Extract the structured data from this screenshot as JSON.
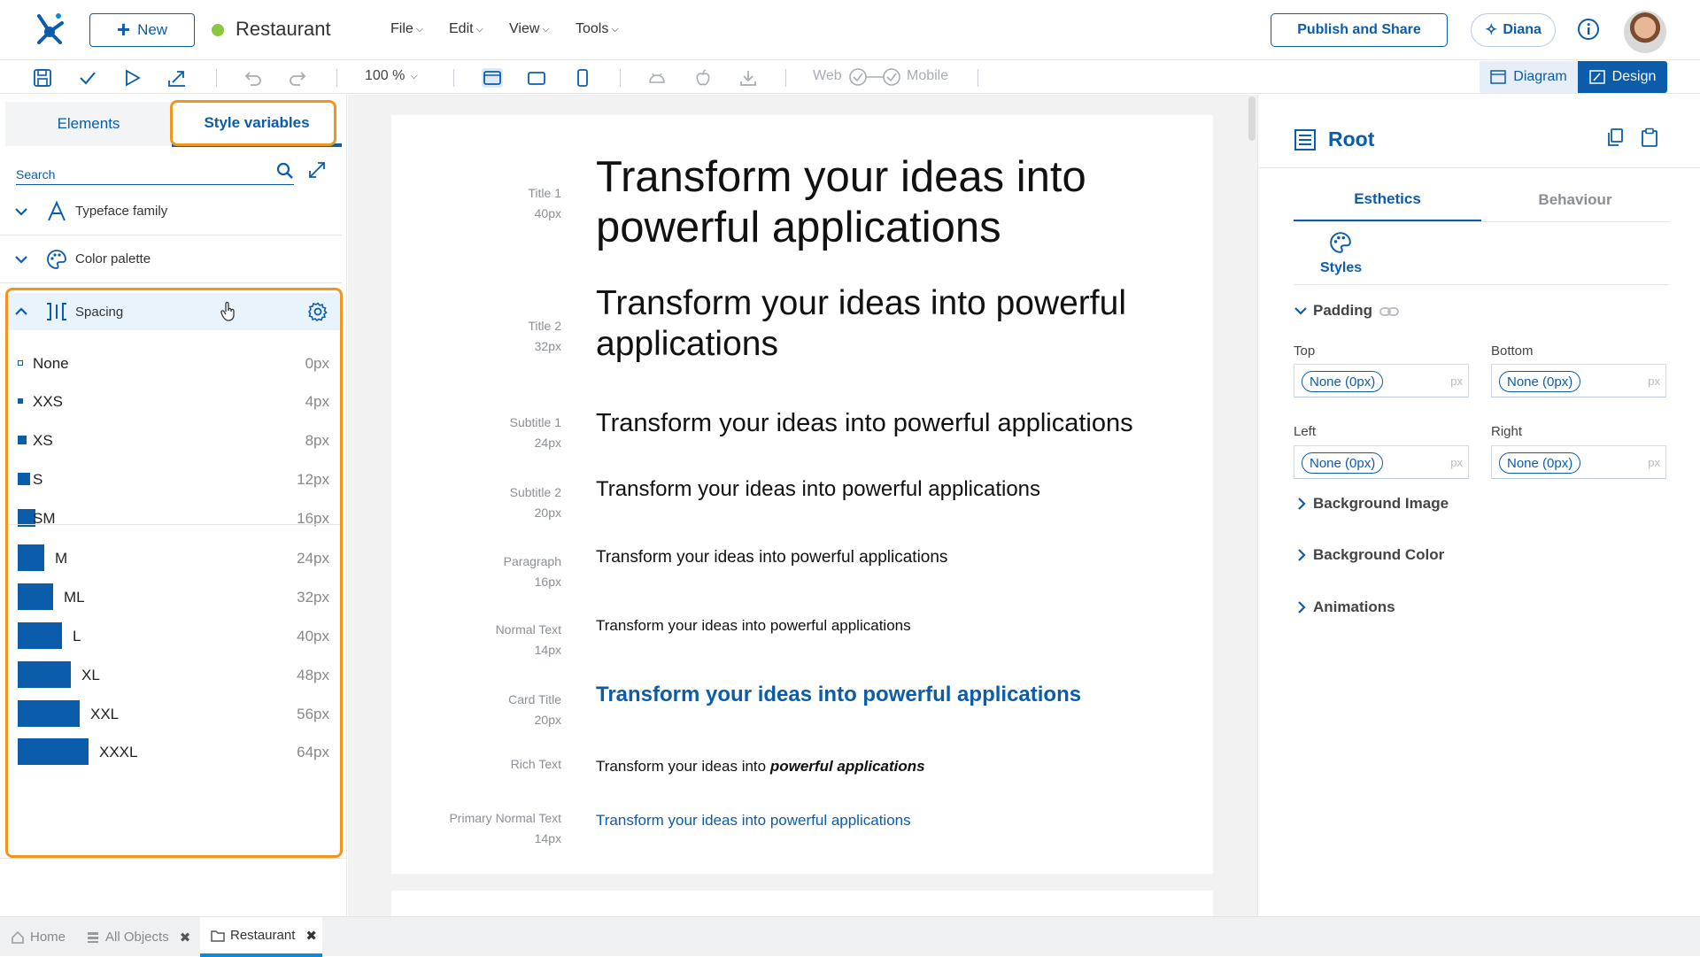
{
  "header": {
    "new_label": "New",
    "app_name": "Restaurant",
    "menus": [
      "File",
      "Edit",
      "View",
      "Tools"
    ],
    "publish_label": "Publish and Share",
    "assistant_label": "Diana"
  },
  "toolbar": {
    "zoom": "100 %",
    "web_label": "Web",
    "mobile_label": "Mobile",
    "diagram_label": "Diagram",
    "design_label": "Design"
  },
  "left": {
    "tabs": [
      "Elements",
      "Style variables"
    ],
    "search_placeholder": "Search",
    "sections": [
      "Typeface family",
      "Color palette",
      "Spacing"
    ],
    "spacing": [
      {
        "name": "None",
        "value": "0px"
      },
      {
        "name": "XXS",
        "value": "4px"
      },
      {
        "name": "XS",
        "value": "8px"
      },
      {
        "name": "S",
        "value": "12px"
      },
      {
        "name": "SM",
        "value": "16px"
      },
      {
        "name": "M",
        "value": "24px"
      },
      {
        "name": "ML",
        "value": "32px"
      },
      {
        "name": "L",
        "value": "40px"
      },
      {
        "name": "XL",
        "value": "48px"
      },
      {
        "name": "XXL",
        "value": "56px"
      },
      {
        "name": "XXXL",
        "value": "64px"
      }
    ]
  },
  "canvas": {
    "rows": [
      {
        "name": "Title 1",
        "size": "40px",
        "text": "Transform your ideas into powerful applications"
      },
      {
        "name": "Title 2",
        "size": "32px",
        "text": "Transform your ideas into powerful applications"
      },
      {
        "name": "Subtitle 1",
        "size": "24px",
        "text": "Transform your ideas into powerful applications"
      },
      {
        "name": "Subtitle 2",
        "size": "20px",
        "text": "Transform your ideas into powerful applications"
      },
      {
        "name": "Paragraph",
        "size": "16px",
        "text": "Transform your ideas into powerful applications"
      },
      {
        "name": "Normal Text",
        "size": "14px",
        "text": "Transform your ideas into powerful applications"
      },
      {
        "name": "Card Title",
        "size": "20px",
        "text": "Transform your ideas into powerful applications"
      },
      {
        "name": "Rich Text",
        "size": "",
        "text": "Transform your ideas into ",
        "emphasis": "powerful applications"
      },
      {
        "name": "Primary Normal Text",
        "size": "14px",
        "text": "Transform your ideas into powerful applications"
      }
    ]
  },
  "right": {
    "title": "Root",
    "tabs": [
      "Esthetics",
      "Behaviour"
    ],
    "styles_label": "Styles",
    "padding_label": "Padding",
    "fields": [
      {
        "label": "Top",
        "value": "None (0px)",
        "unit": "px"
      },
      {
        "label": "Bottom",
        "value": "None (0px)",
        "unit": "px"
      },
      {
        "label": "Left",
        "value": "None (0px)",
        "unit": "px"
      },
      {
        "label": "Right",
        "value": "None (0px)",
        "unit": "px"
      }
    ],
    "sections": [
      "Background Image",
      "Background Color",
      "Animations"
    ]
  },
  "bottom_tabs": [
    "Home",
    "All Objects",
    "Restaurant"
  ],
  "colors": {
    "accent": "#0b5cab",
    "highlight": "#f0961e",
    "status": "#8dc63f"
  }
}
